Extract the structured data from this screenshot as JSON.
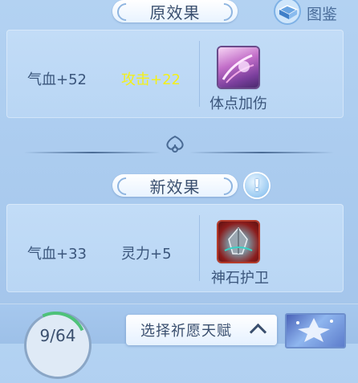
{
  "header": {
    "atlas_label": "图鉴"
  },
  "old_effect": {
    "title": "原效果",
    "stats": [
      "气血+52",
      "攻击+22"
    ],
    "skill_name": "体点加伤",
    "highlight_color": "#f3f01a"
  },
  "new_effect": {
    "title": "新效果",
    "stats": [
      "气血+33",
      "灵力+5"
    ],
    "skill_name": "神石护卫",
    "info_badge": "!"
  },
  "footer": {
    "counter": "9/64",
    "counter_progress": 0.14,
    "wish_button_label": "选择祈愿天赋",
    "wish_button_icon": "chevron-up-icon"
  }
}
